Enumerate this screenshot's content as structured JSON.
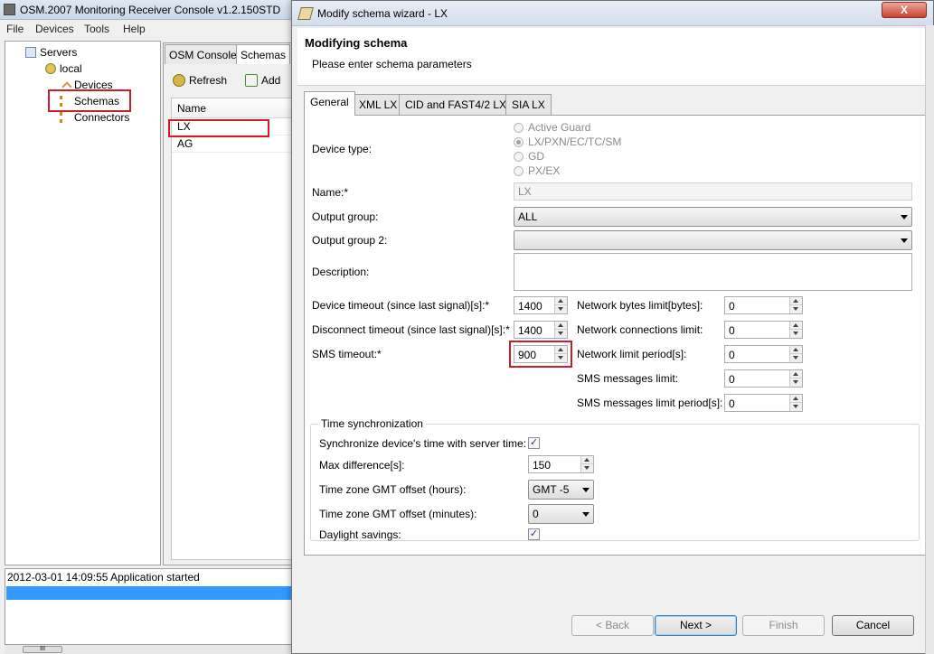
{
  "main_window": {
    "title": "OSM.2007 Monitoring Receiver Console v1.2.150STD",
    "menu": [
      "File",
      "Devices",
      "Tools",
      "Help"
    ],
    "tree": {
      "root": "Servers",
      "server": "local",
      "items": [
        "Devices",
        "Schemas",
        "Connectors"
      ]
    },
    "tabs": [
      "OSM Console",
      "Schemas"
    ],
    "toolbar": {
      "refresh": "Refresh",
      "add": "Add"
    },
    "schema_table": {
      "header": "Name",
      "rows": [
        "LX",
        "AG"
      ]
    },
    "log": {
      "entry": "2012-03-01 14:09:55  Application started"
    },
    "scroll_thumb": "III"
  },
  "dialog": {
    "title": "Modify schema wizard - LX",
    "close_label": "X",
    "heading": "Modifying schema",
    "subheading": "Please enter schema parameters",
    "tabs": [
      "General",
      "XML LX",
      "CID and FAST4/2 LX",
      "SIA LX"
    ],
    "active_tab": "General",
    "general": {
      "device_type_label": "Device type:",
      "device_types": [
        "Active Guard",
        "LX/PXN/EC/TC/SM",
        "GD",
        "PX/EX"
      ],
      "device_type_selected": "LX/PXN/EC/TC/SM",
      "name_label": "Name:*",
      "name_value": "LX",
      "output_group_label": "Output group:",
      "output_group_value": "ALL",
      "output_group2_label": "Output group 2:",
      "output_group2_value": "",
      "description_label": "Description:",
      "description_value": "",
      "device_timeout_label": "Device timeout (since last signal)[s]:*",
      "device_timeout_value": "1400",
      "disconnect_timeout_label": "Disconnect timeout (since last signal)[s]:*",
      "disconnect_timeout_value": "1400",
      "sms_timeout_label": "SMS timeout:*",
      "sms_timeout_value": "900",
      "network_bytes_label": "Network bytes limit[bytes]:",
      "network_bytes_value": "0",
      "network_connections_label": "Network connections limit:",
      "network_connections_value": "0",
      "network_period_label": "Network limit period[s]:",
      "network_period_value": "0",
      "sms_messages_label": "SMS messages limit:",
      "sms_messages_value": "0",
      "sms_period_label": "SMS messages limit period[s]:",
      "sms_period_value": "0"
    },
    "time_sync": {
      "legend": "Time synchronization",
      "sync_label": "Synchronize device's time with server time:",
      "sync_checked": true,
      "max_diff_label": "Max difference[s]:",
      "max_diff_value": "150",
      "tz_hours_label": "Time zone GMT offset (hours):",
      "tz_hours_value": "GMT -5",
      "tz_minutes_label": "Time zone GMT offset (minutes):",
      "tz_minutes_value": "0",
      "dst_label": "Daylight savings:",
      "dst_checked": true,
      "check_mark": "✓"
    },
    "buttons": {
      "back": "< Back",
      "next": "Next >",
      "finish": "Finish",
      "cancel": "Cancel"
    }
  },
  "colors": {
    "highlight_box": "#d11a2a",
    "selection": "#3399ff"
  }
}
